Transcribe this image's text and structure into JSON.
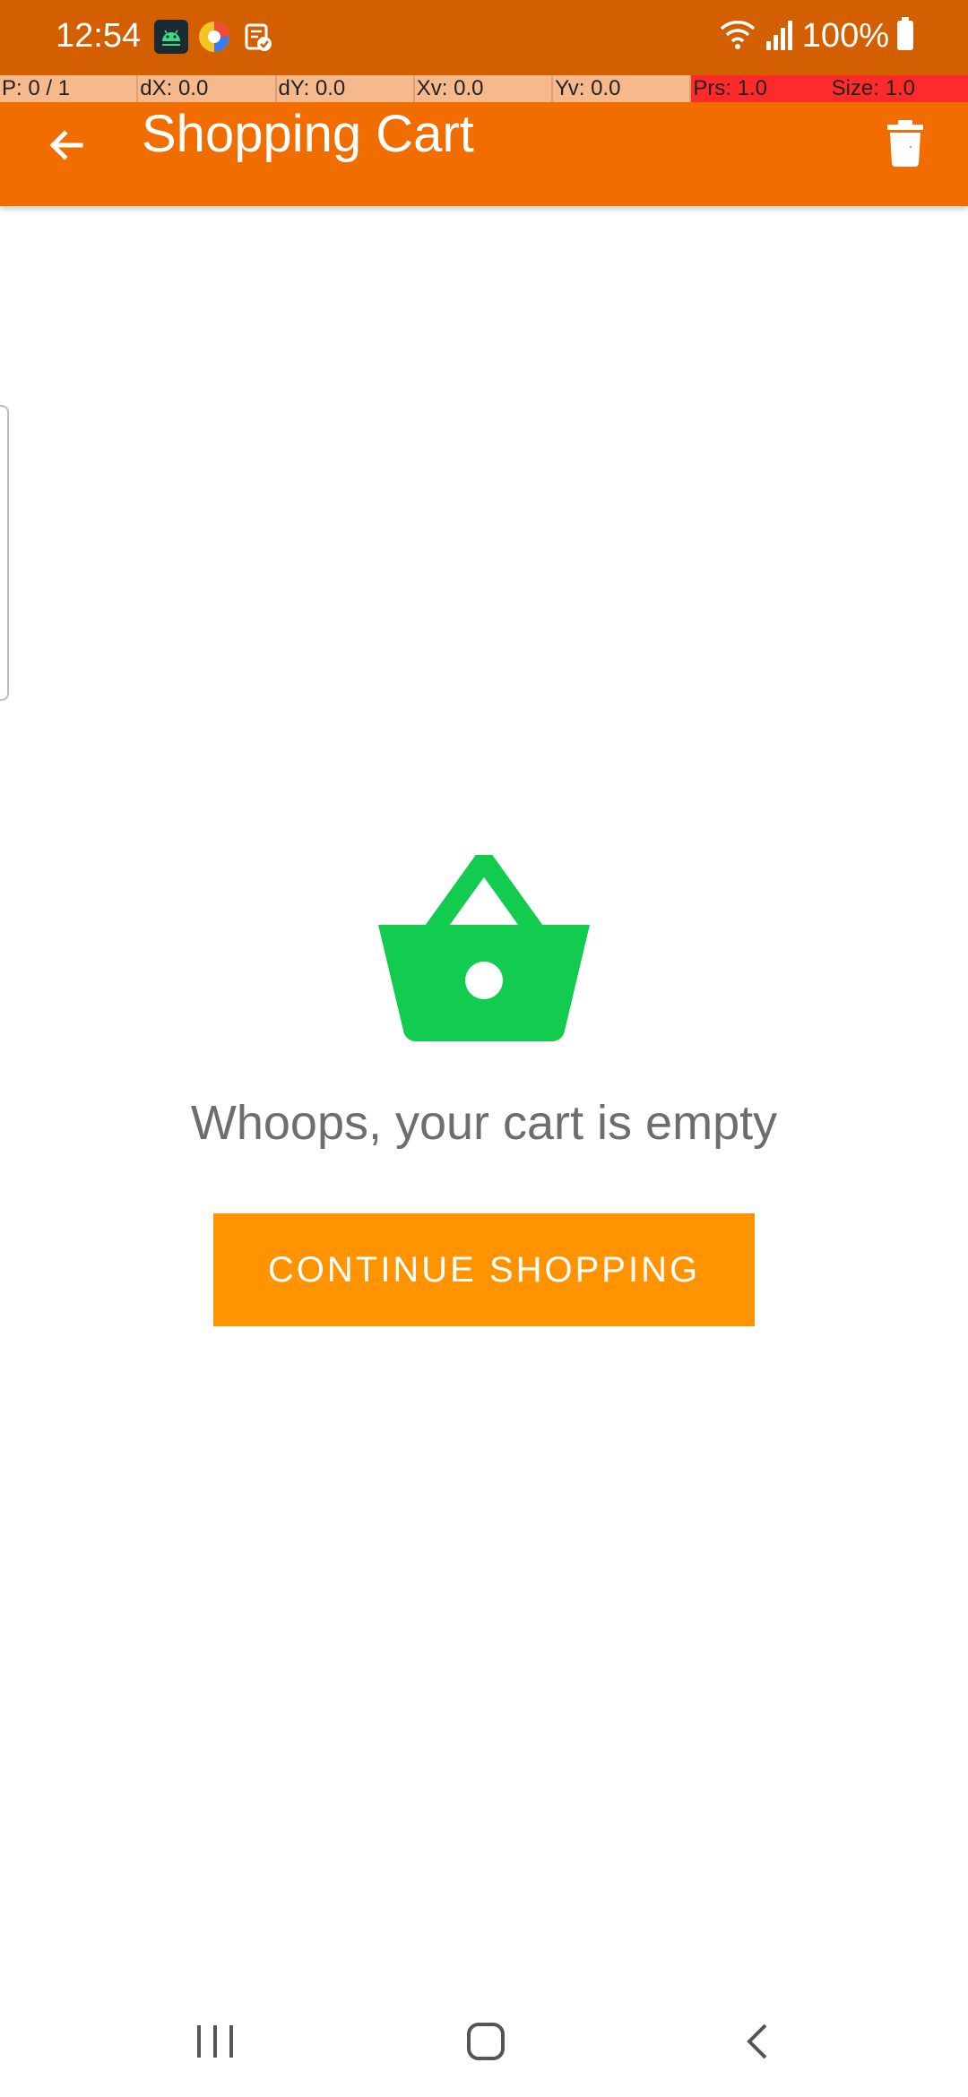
{
  "status_bar": {
    "time": "12:54",
    "battery": "100%",
    "icons": [
      "android-debug-icon",
      "color-picker-app-icon",
      "clipboard-check-icon",
      "wifi-icon",
      "cellular-signal-icon",
      "battery-icon"
    ]
  },
  "debug_overlay": {
    "cells": [
      "P: 0 / 1",
      "dX: 0.0",
      "dY: 0.0",
      "Xv: 0.0",
      "Yv: 0.0",
      "Prs: 1.0",
      "Size: 1.0"
    ]
  },
  "app_bar": {
    "title": "Shopping Cart",
    "back_icon": "arrow-back-icon",
    "delete_icon": "trash-icon",
    "color": "#f26d00"
  },
  "empty_state": {
    "icon": "shopping-basket-icon",
    "icon_color": "#11cc4f",
    "message": "Whoops, your cart is empty",
    "button_label": "CONTINUE SHOPPING",
    "button_color": "#ff9400"
  },
  "nav_bar": {
    "items": [
      "recent-apps-icon",
      "home-icon",
      "back-icon"
    ]
  }
}
